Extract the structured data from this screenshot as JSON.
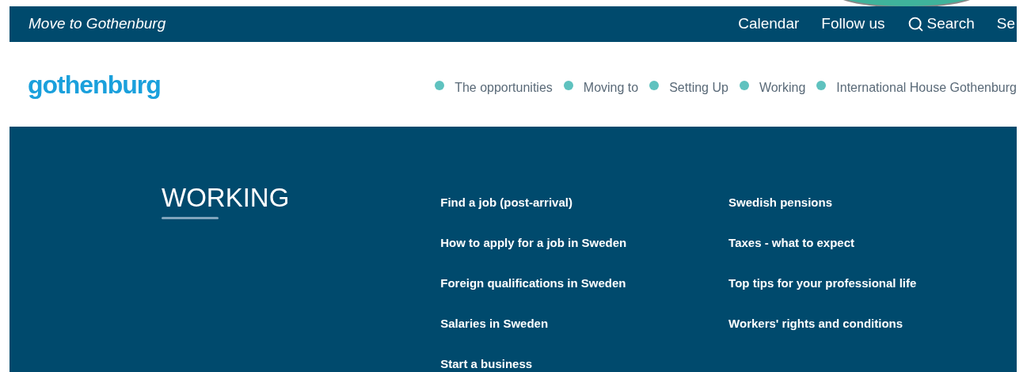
{
  "top_bar": {
    "title": "Move to Gothenburg",
    "links": [
      {
        "label": "Calendar",
        "kind": "text"
      },
      {
        "label": "Follow us",
        "kind": "text"
      },
      {
        "label": "Search",
        "kind": "search"
      },
      {
        "label": "Se",
        "kind": "text"
      }
    ]
  },
  "header": {
    "logo": "gothenburg",
    "nav": [
      {
        "label": "The opportunities"
      },
      {
        "label": "Moving to"
      },
      {
        "label": "Setting Up"
      },
      {
        "label": "Working"
      },
      {
        "label": "International House Gothenburg"
      }
    ]
  },
  "menu": {
    "title": "WORKING",
    "columns": [
      [
        "Find a job (post-arrival)",
        "How to apply for a job in Sweden",
        "Foreign qualifications in Sweden",
        "Salaries in Sweden",
        "Start a business"
      ],
      [
        "Swedish pensions",
        "Taxes - what to expect",
        "Top tips for your professional life",
        "Workers' rights and conditions"
      ]
    ]
  }
}
